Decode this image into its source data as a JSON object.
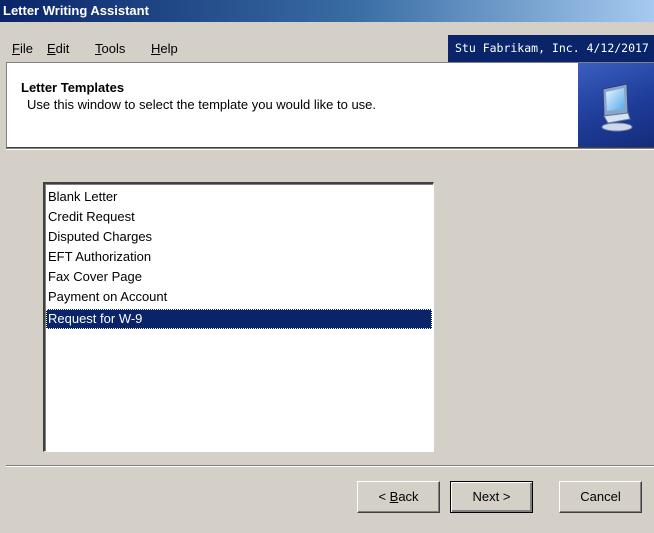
{
  "window": {
    "title": "Letter Writing Assistant"
  },
  "menu": {
    "file": {
      "access": "F",
      "rest": "ile"
    },
    "edit": {
      "access": "E",
      "rest": "dit"
    },
    "tools": {
      "access": "T",
      "rest": "ools"
    },
    "help": {
      "access": "H",
      "rest": "elp"
    }
  },
  "company_info": "Stu Fabrikam, Inc. 4/12/2017",
  "header": {
    "title": "Letter Templates",
    "description": "Use this window to select the template you would like to use."
  },
  "templates": {
    "items": [
      "Blank Letter",
      "Credit Request",
      "Disputed Charges",
      "EFT Authorization",
      "Fax Cover Page",
      "Payment on Account",
      "Request for W-9"
    ],
    "selected": "Request for W-9"
  },
  "buttons": {
    "back_prefix": "< ",
    "back_access": "B",
    "back_rest": "ack",
    "next": "Next >",
    "cancel": "Cancel"
  },
  "colors": {
    "title_bar": "#0a246a",
    "selection": "#0a246a",
    "background": "#d4d0c8"
  },
  "icons": {
    "header": "computer-icon"
  }
}
